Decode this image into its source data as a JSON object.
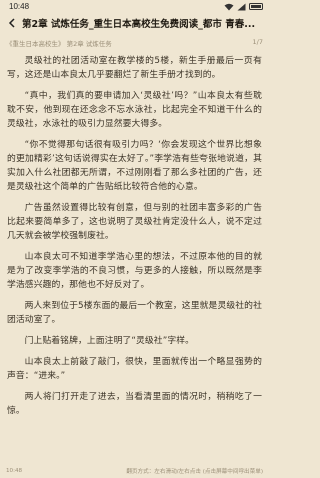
{
  "status_bar": {
    "time": "10:48"
  },
  "header": {
    "title": "第2章 试炼任务_重生日本高校生免费阅读_都市 青春...",
    "breadcrumb": "《重生日本高校生》 第2章 试炼任务",
    "page_indicator": "1/7"
  },
  "paragraphs": [
    "灵级社的社团活动室在教学楼的5楼，新生手册最后一页有写，这还是山本良太几乎要翻烂了新生手册才找到的。",
    "“真中，我们真的要申请加入‘灵级社’吗？”山本良太有些耽耽不安，他到现在还念念不忘水泳社，比起完全不知道干什么的灵级社，水泳社的吸引力显然要大得多。",
    "“你不觉得那句话很有吸引力吗？‘你会发现这个世界比想象的更加精彩’这句话说得实在太好了。”李学浩有些夸张地说道，其实加入什么社团都无所谓，不过刚刚看了那么多社团的广告，还是灵级社这个简单的广告贴纸比较符合他的心意。",
    "广告虽然设置得比较有创意，但与别的社团丰富多彩的广告比起来要简单多了，这也说明了灵级社肯定没什么人，说不定过几天就会被学校强制废社。",
    "山本良太可不知道李学浩心里的想法，不过原本他的目的就是为了改变李学浩的不良习惯，与更多的人接触，所以既然是李学浩感兴趣的，那他也不好反对了。",
    "两人来到位于5楼东面的最后一个教室，这里就是灵级社的社团活动室了。",
    "门上贴着铭牌，上面注明了“灵级社”字样。",
    "山本良太上前敲了敲门，很快，里面就传出一个略显强势的声音：“进来。”",
    "两人将门打开走了进去，当看清里面的情况时，稍稍吃了一惊。"
  ],
  "footer": {
    "time": "10:48",
    "hint": "翻页方式：左右滑动/左右点击 (点击屏幕中间呼出菜单)"
  },
  "colors": {
    "background": "#efe6d2",
    "text": "#3a3226",
    "muted": "#9b8f78"
  }
}
